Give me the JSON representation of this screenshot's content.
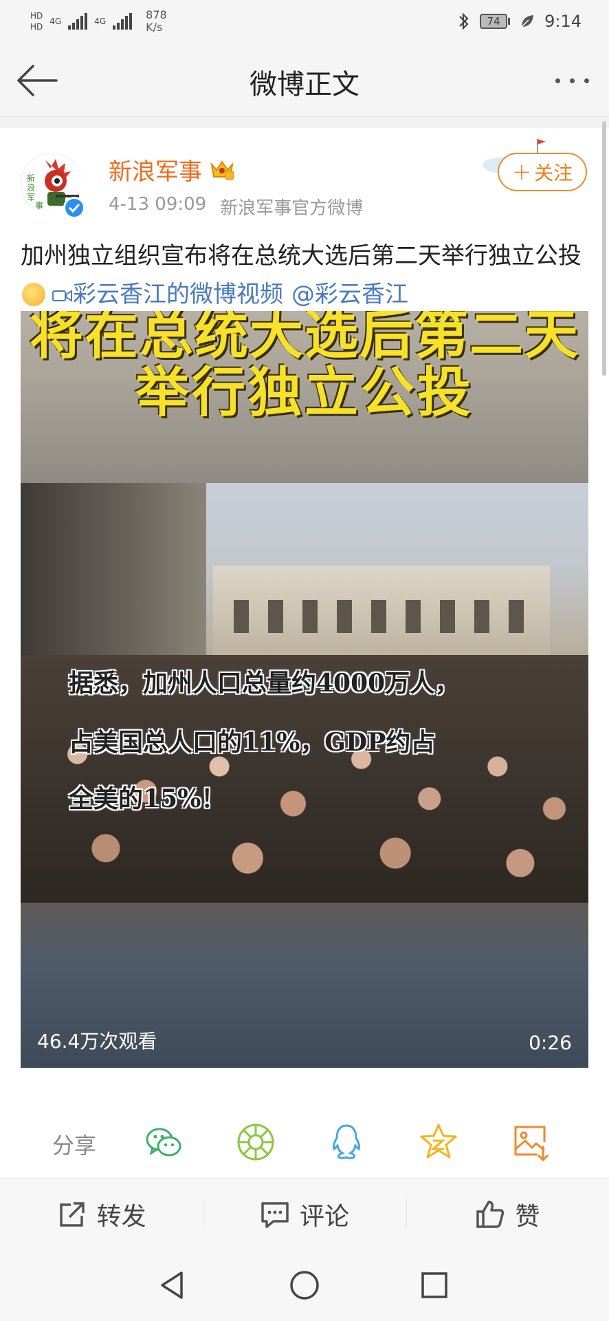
{
  "status_bar": {
    "hd1": "HD",
    "hd2": "HD",
    "net1": "4G",
    "net2": "4G",
    "speed_value": "878",
    "speed_unit": "K/s",
    "battery": "74",
    "time": "9:14"
  },
  "nav": {
    "title": "微博正文"
  },
  "post": {
    "username": "新浪军事",
    "time": "4-13 09:09",
    "source": "新浪军事官方微博",
    "follow_label": "关注",
    "text": "加州独立组织宣布将在总统大选后第二天举行独立公投",
    "video_link": "彩云香江的微博视频",
    "mention": "@彩云香江"
  },
  "video": {
    "title_line1": "将在总统大选后第二天",
    "title_line2": "举行独立公投",
    "caption_line1": "据悉，加州人口总量约4000万人，",
    "caption_line2": "占美国总人口的11%，GDP约占",
    "caption_line3": "全美的15%！",
    "views": "46.4万次观看",
    "duration": "0:26"
  },
  "share": {
    "label": "分享",
    "targets": [
      "wechat-icon",
      "moments-icon",
      "qq-icon",
      "qzone-icon",
      "save-image-icon"
    ]
  },
  "actions": {
    "repost": "转发",
    "comment": "评论",
    "like": "赞"
  },
  "colors": {
    "username": "#f26b1c",
    "follow": "#f07d1a",
    "link": "#4a7bbf",
    "subtitle_yellow": "#f7e12a"
  }
}
